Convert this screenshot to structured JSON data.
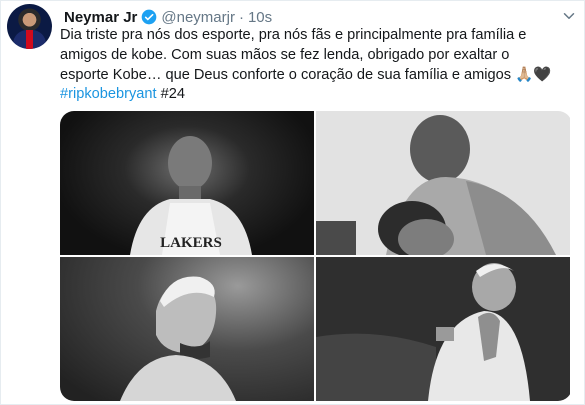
{
  "tweet": {
    "author_name": "Neymar Jr",
    "handle": "@neymarjr",
    "separator": "·",
    "timestamp": "10s",
    "text_lines": [
      "Dia triste pra nós dos esporte, pra nós fãs e principalmente pra família e",
      "amigos de kobe. Com suas mãos se fez lenda, obrigado por exaltar o",
      "esporte Kobe… que Deus conforte o coração de sua família e amigos 🙏🏼🖤"
    ],
    "hashtag": "#ripkobebryant",
    "number_tag": "#24",
    "jersey_text": "LAKERS"
  },
  "icons": {
    "verified": "verified-badge-icon",
    "menu": "chevron-down-icon"
  },
  "colors": {
    "link": "#1b95e0",
    "secondary_text": "#657786",
    "verified": "#1da1f2"
  }
}
